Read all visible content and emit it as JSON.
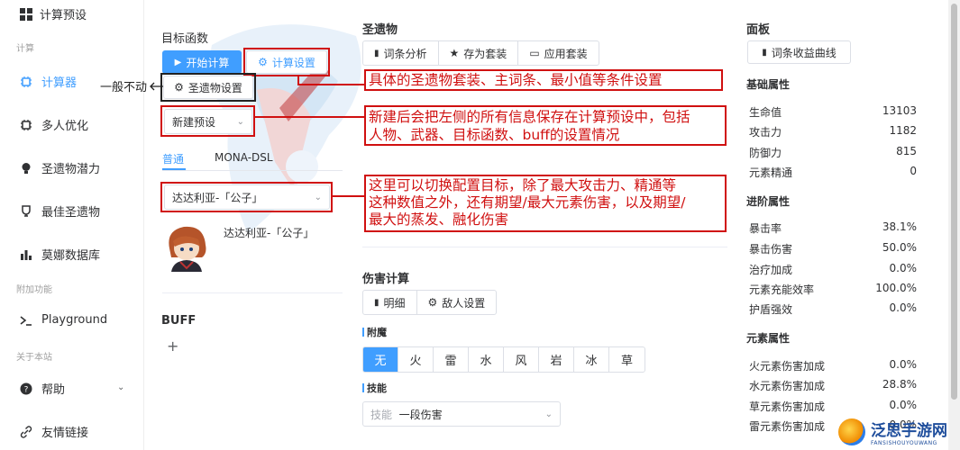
{
  "sidebar": {
    "header": "计算预设",
    "sections": [
      "计算",
      "附加功能",
      "关于本站"
    ],
    "items": [
      {
        "label": "计算器",
        "icon": "chip-icon",
        "active": true
      },
      {
        "label": "多人优化",
        "icon": "chip-icon"
      },
      {
        "label": "圣遗物潜力",
        "icon": "bulb-icon"
      },
      {
        "label": "最佳圣遗物",
        "icon": "trophy-icon"
      },
      {
        "label": "莫娜数据库",
        "icon": "bar-chart-icon"
      },
      {
        "label": "Playground",
        "icon": "terminal-icon"
      },
      {
        "label": "帮助",
        "icon": "help-icon"
      },
      {
        "label": "友情链接",
        "icon": "link-icon"
      }
    ]
  },
  "target": {
    "title": "目标函数",
    "start_button": "开始计算",
    "settings_button": "计算设置",
    "artifact_settings_button": "圣遗物设置",
    "preset_select": "新建预设",
    "tabs": [
      "普通",
      "MONA-DSL"
    ],
    "character_select": "达达利亚-「公子」",
    "character_name": "达达利亚-「公子」",
    "buff_title": "BUFF",
    "add_symbol": "+"
  },
  "annotations": {
    "side_note": "一般不动",
    "note1": "具体的圣遗物套装、主词条、最小值等条件设置",
    "note2_line1": "新建后会把左侧的所有信息保存在计算预设中，包括",
    "note2_line2": "人物、武器、目标函数、buff的设置情况",
    "note3_line1": "这里可以切换配置目标，除了最大攻击力、精通等",
    "note3_line2": "这种数值之外，还有期望/最大元素伤害，以及期望/",
    "note3_line3": "最大的蒸发、融化伤害"
  },
  "artifacts": {
    "title": "圣遗物",
    "buttons": [
      "词条分析",
      "存为套装",
      "应用套装"
    ]
  },
  "damage": {
    "title": "伤害计算",
    "buttons": [
      "明细",
      "敌人设置"
    ],
    "infusion_label": "附魔",
    "elements": [
      "无",
      "火",
      "雷",
      "水",
      "风",
      "岩",
      "冰",
      "草"
    ],
    "selected_element": "无",
    "skill_label": "技能",
    "skill_prefix": "技能",
    "skill_value": "一段伤害"
  },
  "panel": {
    "title": "面板",
    "curve_button": "词条收益曲线",
    "basic_title": "基础属性",
    "basic": [
      {
        "name": "生命值",
        "value": "13103"
      },
      {
        "name": "攻击力",
        "value": "1182"
      },
      {
        "name": "防御力",
        "value": "815"
      },
      {
        "name": "元素精通",
        "value": "0"
      }
    ],
    "advanced_title": "进阶属性",
    "advanced": [
      {
        "name": "暴击率",
        "value": "38.1%"
      },
      {
        "name": "暴击伤害",
        "value": "50.0%"
      },
      {
        "name": "治疗加成",
        "value": "0.0%"
      },
      {
        "name": "元素充能效率",
        "value": "100.0%"
      },
      {
        "name": "护盾强效",
        "value": "0.0%"
      }
    ],
    "element_title": "元素属性",
    "element": [
      {
        "name": "火元素伤害加成",
        "value": "0.0%"
      },
      {
        "name": "水元素伤害加成",
        "value": "28.8%"
      },
      {
        "name": "草元素伤害加成",
        "value": "0.0%"
      },
      {
        "name": "雷元素伤害加成",
        "value": "0.0%"
      }
    ]
  },
  "watermark": {
    "name": "泛思手游网",
    "sub": "FANSISHOUYOUWANG"
  },
  "colors": {
    "accent": "#409eff",
    "annotation": "#d01010"
  }
}
